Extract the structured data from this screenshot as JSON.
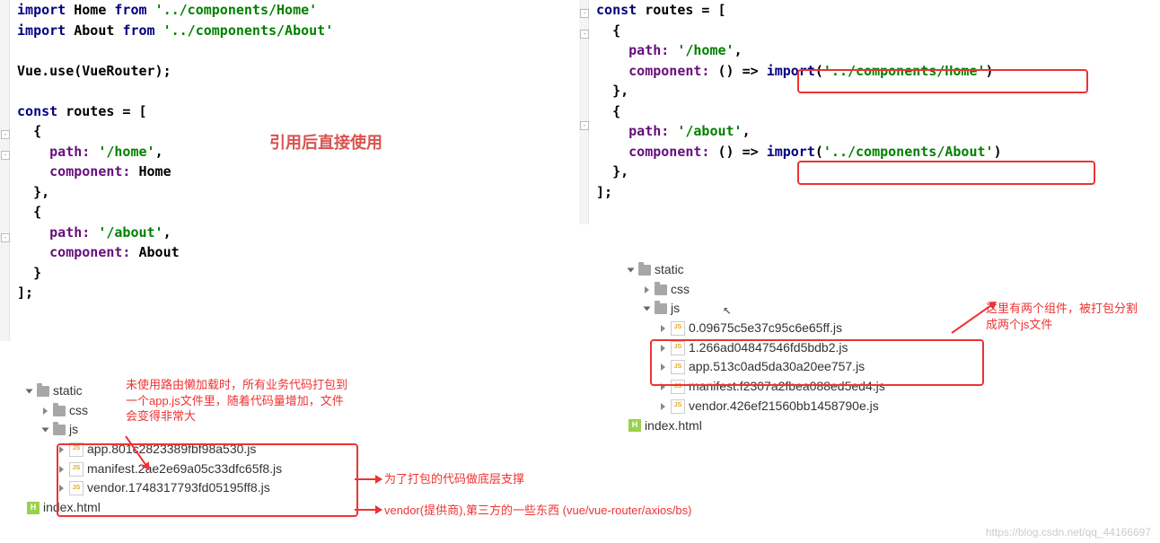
{
  "left_code": {
    "l1_import": "import",
    "l1_home": "Home",
    "l1_from": "from",
    "l1_path": "'../components/Home'",
    "l2_import": "import",
    "l2_about": "About",
    "l2_from": "from",
    "l2_path": "'../components/About'",
    "vue": "Vue",
    "use": ".use(VueRouter);",
    "const": "const",
    "routes": "routes = [",
    "obj_open": "{",
    "path_label": "path:",
    "home_path": "'/home'",
    "comp_label": "component:",
    "home_comp": "Home",
    "close_comma": "},",
    "about_path": "'/about'",
    "about_comp": "About",
    "close": "}",
    "arr_close": "];",
    "title": "引用后直接使用"
  },
  "right_code": {
    "const": "const",
    "routes": "routes = [",
    "obj_open": "{",
    "path_label": "path:",
    "home_path": "'/home'",
    "comp_label": "component:",
    "arrow": "() =>",
    "import_kw": "import",
    "home_imp": "'../components/Home'",
    "close_comma": "},",
    "about_path": "'/about'",
    "about_imp": "'../components/About'",
    "arr_close": "];"
  },
  "left_tree": {
    "static": "static",
    "css": "css",
    "js": "js",
    "files": [
      "app.801c2823389fbf98a530.js",
      "manifest.2ae2e69a05c33dfc65f8.js",
      "vendor.1748317793fd05195ff8.js"
    ],
    "index": "index.html"
  },
  "right_tree": {
    "static": "static",
    "css": "css",
    "js": "js",
    "files": [
      "0.09675c5e37c95c6e65ff.js",
      "1.266ad04847546fd5bdb2.js",
      "app.513c0ad5da30a20ee757.js",
      "manifest.f2307a2fbea088ed5ed4.js",
      "vendor.426ef21560bb1458790e.js"
    ],
    "index": "index.html"
  },
  "annotations": {
    "a1": "未使用路由懒加载时，所有业务代码打包到一个app.js文件里，随着代码量增加，文件会变得非常大",
    "a2": "为了打包的代码做底层支撑",
    "a3": "vendor(提供商),第三方的一些东西  (vue/vue-router/axios/bs)",
    "a4": "这里有两个组件，被打包分割成两个js文件"
  },
  "watermark": "https://blog.csdn.net/qq_44166697"
}
